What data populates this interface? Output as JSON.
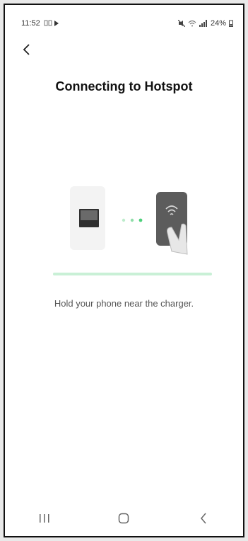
{
  "status_bar": {
    "time": "11:52",
    "battery": "24%"
  },
  "screen": {
    "title": "Connecting to Hotspot",
    "hint": "Hold your phone near the charger.",
    "progress": 1.0
  },
  "icons": {
    "back": "chevron-left-icon",
    "charger": "charger-device-icon",
    "phone": "phone-in-hand-icon",
    "nav_recent": "recent-apps-icon",
    "nav_home": "home-icon",
    "nav_back": "back-icon"
  },
  "colors": {
    "accent_green": "#4cd07a",
    "progress_track": "#dff3e6"
  }
}
